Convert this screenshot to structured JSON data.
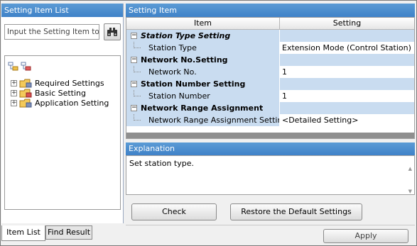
{
  "left_panel": {
    "header": "Setting Item List",
    "search_placeholder": "Input the Setting Item to S",
    "tree": [
      {
        "label": "Required Settings"
      },
      {
        "label": "Basic Setting"
      },
      {
        "label": "Application Setting"
      }
    ],
    "tabs": [
      "Item List",
      "Find Result"
    ]
  },
  "right_panel": {
    "header": "Setting Item",
    "columns": [
      "Item",
      "Setting"
    ],
    "rows": [
      {
        "type": "category",
        "item": "Station Type Setting",
        "setting": ""
      },
      {
        "type": "setting",
        "item": "Station Type",
        "setting": "Extension Mode (Control Station)"
      },
      {
        "type": "category",
        "item": "Network No.Setting",
        "setting": ""
      },
      {
        "type": "setting",
        "item": "Network No.",
        "setting": "1"
      },
      {
        "type": "category",
        "item": "Station Number Setting",
        "setting": ""
      },
      {
        "type": "setting",
        "item": "Station Number",
        "setting": "1"
      },
      {
        "type": "category",
        "item": "Network Range Assignment",
        "setting": ""
      },
      {
        "type": "setting",
        "item": "Network Range Assignment Setting",
        "setting": "<Detailed Setting>"
      }
    ],
    "explanation_header": "Explanation",
    "explanation_text": "Set station type.",
    "check_label": "Check",
    "restore_label": "Restore the Default Settings",
    "apply_label": "Apply"
  },
  "colors": {
    "header_blue": "#4a90d9",
    "row_blue": "#c9dcf0"
  }
}
